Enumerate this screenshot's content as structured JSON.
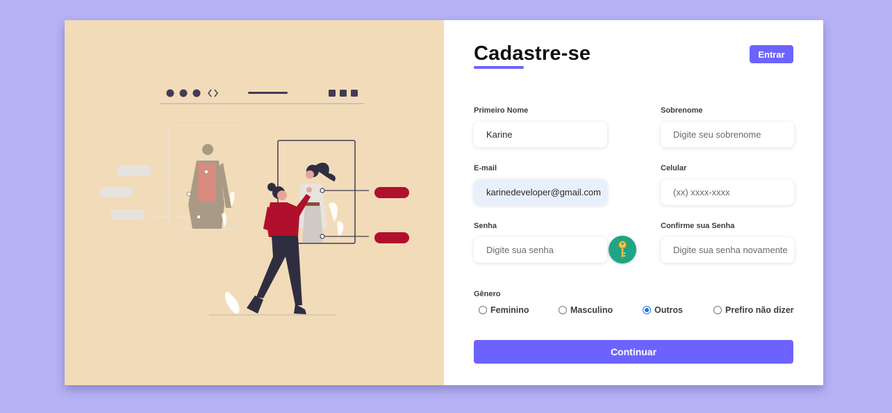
{
  "form": {
    "title": "Cadastre-se",
    "login_button": "Entrar",
    "first_name": {
      "label": "Primeiro Nome",
      "value": "Karine",
      "placeholder": ""
    },
    "last_name": {
      "label": "Sobrenome",
      "value": "",
      "placeholder": "Digite seu sobrenome"
    },
    "email": {
      "label": "E-mail",
      "value": "karinedeveloper@gmail.com",
      "placeholder": ""
    },
    "phone": {
      "label": "Celular",
      "value": "",
      "placeholder": "(xx) xxxx-xxxx"
    },
    "password": {
      "label": "Senha",
      "value": "",
      "placeholder": "Digite sua senha"
    },
    "confirm_password": {
      "label": "Confirme sua Senha",
      "value": "",
      "placeholder": "Digite sua senha novamente"
    },
    "gender": {
      "label": "Gênero",
      "options": [
        "Feminino",
        "Masculino",
        "Outros",
        "Prefiro não dizer"
      ],
      "selected": "Outros"
    },
    "continue_button": "Continuar"
  },
  "icons": {
    "password_manager": "key-icon"
  },
  "colors": {
    "page_bg": "#b4b1f5",
    "illustration_bg": "#f2dbb8",
    "accent": "#6c63ff",
    "illustration_red": "#b0102c",
    "key_badge": "#1ea585"
  }
}
